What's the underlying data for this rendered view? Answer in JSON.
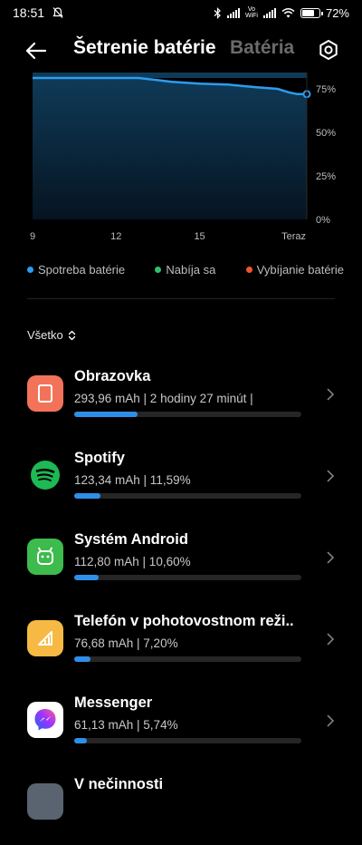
{
  "status": {
    "time": "18:51",
    "volte_top": "Vo",
    "volte_bottom": "WiFi",
    "battery_percent": "72%",
    "battery_level": 0.72
  },
  "header": {
    "title": "Šetrenie batérie",
    "tab_inactive": "Batéria"
  },
  "chart_data": {
    "type": "area",
    "x_ticks": [
      "9",
      "12",
      "15",
      "Teraz"
    ],
    "y_ticks": [
      "75%",
      "50%",
      "25%",
      "0%"
    ],
    "ylim": [
      0,
      100
    ],
    "grid": false,
    "series": [
      {
        "name": "Spotreba batérie",
        "x": [
          9,
          10,
          11,
          12,
          12.8,
          13.5,
          14,
          15,
          16,
          17,
          17.8,
          18.2,
          18.5,
          18.85
        ],
        "y": [
          85,
          85,
          85,
          85,
          84,
          80,
          79,
          78,
          77.5,
          76,
          75,
          73,
          72,
          72
        ]
      }
    ],
    "colors": {
      "line": "#2d9cf0",
      "charging": "#2ec16a",
      "discharging": "#f0552d"
    }
  },
  "legend": [
    {
      "label": "Spotreba batérie",
      "color": "#2d9cf0"
    },
    {
      "label": "Nabíja sa",
      "color": "#2ec16a"
    },
    {
      "label": "Vybíjanie batérie",
      "color": "#f0552d"
    }
  ],
  "filter": {
    "label": "Všetko"
  },
  "apps": [
    {
      "name": "Obrazovka",
      "detail": "293,96 mAh | 2 hodiny 27 minút  |",
      "fraction": 0.28,
      "icon": "screen-icon",
      "color": "#f2735a"
    },
    {
      "name": "Spotify",
      "detail": "123,34 mAh | 11,59%",
      "fraction": 0.1159,
      "icon": "spotify-icon",
      "color": "#1db954"
    },
    {
      "name": "Systém Android",
      "detail": "112,80 mAh | 10,60%",
      "fraction": 0.106,
      "icon": "android-icon",
      "color": "#3dbb4c"
    },
    {
      "name": "Telefón v pohotovostnom reži..",
      "detail": "76,68 mAh | 7,20%",
      "fraction": 0.072,
      "icon": "standby-signal-icon",
      "color": "#f6b944"
    },
    {
      "name": "Messenger",
      "detail": "61,13 mAh | 5,74%",
      "fraction": 0.0574,
      "icon": "messenger-icon",
      "color": "#ffffff"
    },
    {
      "name": "V nečinnosti",
      "detail": "",
      "fraction": 0.05,
      "icon": "idle-icon",
      "color": "#5a6470"
    }
  ]
}
